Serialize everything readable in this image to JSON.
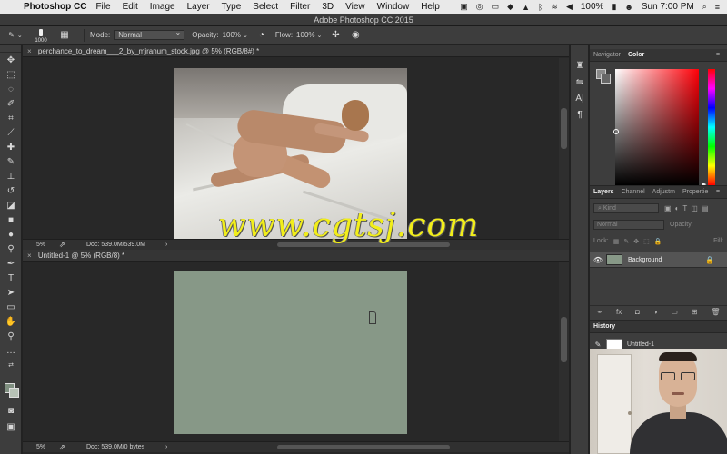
{
  "menubar": {
    "app_name": "Photoshop CC",
    "items": [
      "File",
      "Edit",
      "Image",
      "Layer",
      "Type",
      "Select",
      "Filter",
      "3D",
      "View",
      "Window",
      "Help"
    ],
    "battery": "100%",
    "clock": "Sun 7:00 PM"
  },
  "window": {
    "title": "Adobe Photoshop CC 2015"
  },
  "options": {
    "brush_size": "1000",
    "mode_label": "Mode:",
    "mode_value": "Normal",
    "opacity_label": "Opacity:",
    "opacity_value": "100%",
    "flow_label": "Flow:",
    "flow_value": "100%"
  },
  "documents": [
    {
      "tab": "perchance_to_dream___2_by_mjranum_stock.jpg @ 5% (RGB/8#) *",
      "zoom": "5%",
      "info": "Doc: 539.0M/539.0M"
    },
    {
      "tab": "Untitled-1 @ 5% (RGB/8) *",
      "zoom": "5%",
      "info": "Doc: 539.0M/0 bytes"
    }
  ],
  "watermark": "www.cgtsj.com",
  "panels": {
    "color_tabs": [
      "Navigator",
      "Color"
    ],
    "layers_tabs": [
      "Layers",
      "Channel",
      "Adjustm",
      "Propertie"
    ],
    "kind_placeholder": "Kind",
    "blend_mode": "Normal",
    "opacity_label": "Opacity:",
    "lock_label": "Lock:",
    "fill_label": "Fill:",
    "layer_name": "Background",
    "history_title": "History",
    "history_entry": "Untitled-1"
  },
  "colors": {
    "canvas_fill": "#879887",
    "watermark": "#f2ee1a"
  }
}
